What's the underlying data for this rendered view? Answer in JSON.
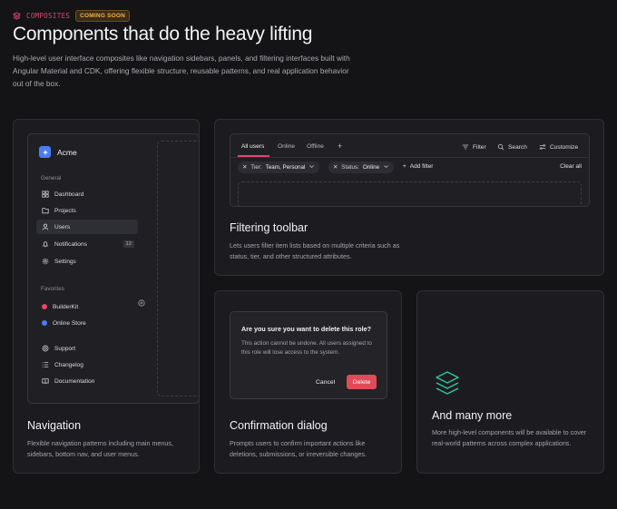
{
  "header": {
    "eyebrow_icon": "composites-icon",
    "eyebrow": "COMPOSITES",
    "badge": "COMING SOON",
    "title": "Components that do the heavy lifting",
    "description": "High-level user interface composites like navigation sidebars, panels, and filtering interfaces built with Angular Material and CDK, offering flexible structure, reusable patterns, and real application behavior out of the box."
  },
  "colors": {
    "accent": "#e5456f",
    "badge": "#f0b24a",
    "danger": "#e04b57",
    "success": "#2fc59a",
    "brand": "#4b7cf3"
  },
  "navigation_card": {
    "title": "Navigation",
    "description": "Flexible navigation patterns including main menus, sidebars, bottom nav, and user menus.",
    "brand": "Acme",
    "general_label": "General",
    "items": [
      {
        "label": "Dashboard",
        "icon": "grid-icon"
      },
      {
        "label": "Projects",
        "icon": "folder-icon"
      },
      {
        "label": "Users",
        "icon": "user-icon",
        "active": true
      },
      {
        "label": "Notifications",
        "icon": "bell-icon",
        "count": "12"
      },
      {
        "label": "Settings",
        "icon": "gear-icon"
      }
    ],
    "favorites_label": "Favorites",
    "favorites": [
      {
        "label": "BuilderKit",
        "color": "#e5456f"
      },
      {
        "label": "Online Store",
        "color": "#4b7cf3"
      }
    ],
    "footer_items": [
      {
        "label": "Support",
        "icon": "help-circle-icon"
      },
      {
        "label": "Changelog",
        "icon": "list-icon"
      },
      {
        "label": "Documentation",
        "icon": "book-icon"
      }
    ]
  },
  "filtering_card": {
    "title": "Filtering toolbar",
    "description": "Lets users filter item lists based on multiple criteria such as status, tier, and other structured attributes.",
    "tabs": [
      "All users",
      "Online",
      "Offline"
    ],
    "add_tab": "+",
    "tools": [
      "Filter",
      "Search",
      "Customize"
    ],
    "chips": [
      {
        "key": "Tier:",
        "value": "Team, Personal"
      },
      {
        "key": "Status:",
        "value": "Online"
      }
    ],
    "add_filter": "Add filter",
    "clear_all": "Clear all"
  },
  "dialog_card": {
    "title": "Confirmation dialog",
    "description": "Prompts users to confirm important actions like deletions, submissions, or irreversible changes.",
    "dialog_title": "Are you sure you want to delete this role?",
    "dialog_body": "This action cannot be undone. All users assigned to this role will lose access to the system.",
    "cancel": "Cancel",
    "delete": "Delete"
  },
  "more_card": {
    "title": "And many more",
    "description": "More high-level components will be available to cover real-world patterns across complex applications."
  }
}
